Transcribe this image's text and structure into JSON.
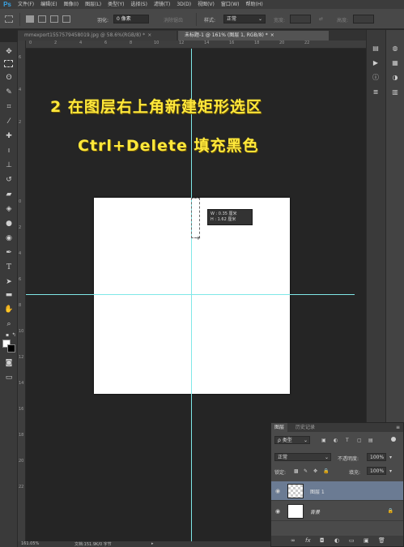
{
  "app": {
    "logo": "Ps"
  },
  "menu": [
    "文件(F)",
    "编辑(E)",
    "图像(I)",
    "图层(L)",
    "类型(Y)",
    "选择(S)",
    "滤镜(T)",
    "3D(D)",
    "视图(V)",
    "窗口(W)",
    "帮助(H)"
  ],
  "options": {
    "feather_label": "羽化:",
    "feather_value": "0 像素",
    "antialias_label": "消除锯齿",
    "style_label": "样式:",
    "style_value": "正常",
    "width_label": "宽度:",
    "height_label": "高度:"
  },
  "tabs": [
    {
      "label": "mmexport1557579458019.jpg @ 58.6%(RGB/8) *",
      "close": "×"
    },
    {
      "label": "未标题-1 @ 161% (图层 1, RGB/8) *",
      "close": "×"
    }
  ],
  "rulers": {
    "top": [
      "0",
      "2",
      "4",
      "6",
      "8",
      "10",
      "12",
      "14",
      "16",
      "18",
      "20",
      "22"
    ],
    "left": [
      "6",
      "4",
      "2",
      "0",
      "2",
      "4",
      "6",
      "8",
      "10",
      "12",
      "14",
      "16",
      "18",
      "20",
      "22"
    ]
  },
  "captions": {
    "line1": "2 在图层右上角新建矩形选区",
    "line2": "Ctrl+Delete 填充黑色"
  },
  "tooltip": {
    "w": "W : 0.35 厘米",
    "h": "H : 1.62 厘米"
  },
  "status": {
    "zoom": "161.05%",
    "doc": "文档:151.9K/0 字节"
  },
  "layers_panel": {
    "tab_layers": "图层",
    "tab_history": "历史记录",
    "filter_kind": "ρ 类型",
    "blend_mode": "正常",
    "opacity_label": "不透明度:",
    "opacity_value": "100%",
    "lock_label": "锁定:",
    "fill_label": "填充:",
    "fill_value": "100%",
    "layers": [
      {
        "name": "图层 1",
        "selected": true
      },
      {
        "name": "背景",
        "selected": false
      }
    ],
    "footer": [
      "∞",
      "fx",
      "◘",
      "◐",
      "▭",
      "▣",
      "🗑"
    ]
  },
  "colors": {
    "caption": "#ffe83b",
    "guide": "#7fe8e8",
    "selected_layer": "#6b7b93"
  }
}
